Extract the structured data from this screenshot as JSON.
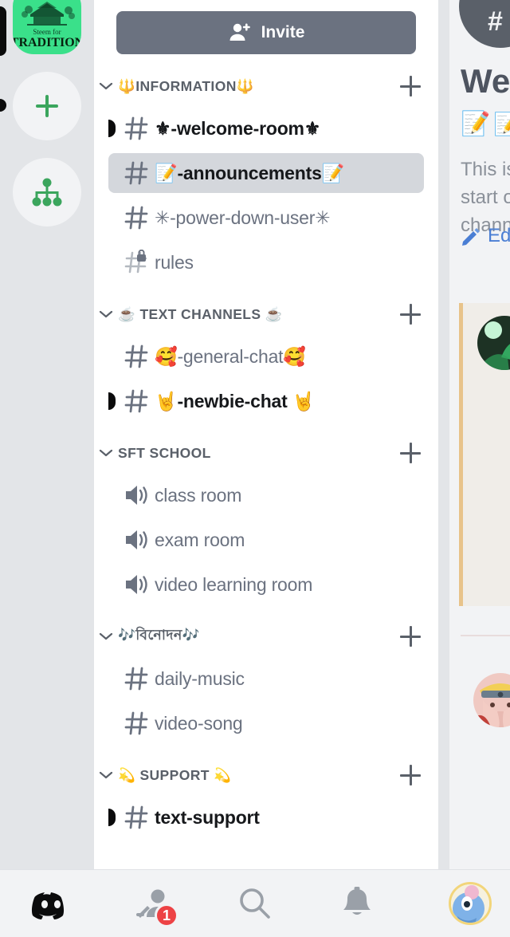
{
  "server_rail": {
    "active_server": {
      "name": "Steem for TRADITION",
      "brand_color": "#3ae08a",
      "line1": "Steem for",
      "line2": "TRADITION"
    },
    "add_server_label": "+",
    "explore_label": "Explore Public Servers"
  },
  "channel_panel": {
    "invite": {
      "label": "Invite",
      "icon": "person-add-icon",
      "bg": "#6b7280"
    },
    "selected_channel": "📝-announcements",
    "categories": [
      {
        "label": "🔱INFORMATION🔱",
        "add_label": "+",
        "channels": [
          {
            "name": "⚜-welcome-room⚜",
            "type": "text",
            "unread": true,
            "selected": false,
            "locked": false
          },
          {
            "name": "📝-announcements📝",
            "type": "text",
            "unread": false,
            "selected": true,
            "locked": false
          },
          {
            "name": "✳-power-down-user✳",
            "type": "text",
            "unread": false,
            "selected": false,
            "locked": false
          },
          {
            "name": "rules",
            "type": "text",
            "unread": false,
            "selected": false,
            "locked": true
          }
        ]
      },
      {
        "label": "☕ TEXT CHANNELS ☕",
        "add_label": "+",
        "channels": [
          {
            "name": "🥰-general-chat🥰",
            "type": "text",
            "unread": false,
            "selected": false,
            "locked": false
          },
          {
            "name": "🤘-newbie-chat 🤘",
            "type": "text",
            "unread": true,
            "selected": false,
            "locked": false
          }
        ]
      },
      {
        "label": "SFT SCHOOL",
        "add_label": "+",
        "channels": [
          {
            "name": "class room",
            "type": "voice",
            "unread": false,
            "selected": false,
            "locked": false
          },
          {
            "name": "exam room",
            "type": "voice",
            "unread": false,
            "selected": false,
            "locked": false
          },
          {
            "name": "video learning room",
            "type": "voice",
            "unread": false,
            "selected": false,
            "locked": false
          }
        ]
      },
      {
        "label": "🎶বিনোদন🎶",
        "add_label": "+",
        "channels": [
          {
            "name": "daily-music",
            "type": "text",
            "unread": false,
            "selected": false,
            "locked": false
          },
          {
            "name": "video-song",
            "type": "text",
            "unread": false,
            "selected": false,
            "locked": false
          }
        ]
      },
      {
        "label": "💫 SUPPORT 💫",
        "add_label": "+",
        "channels": [
          {
            "name": "text-support",
            "type": "text",
            "unread": true,
            "selected": false,
            "locked": false
          }
        ]
      }
    ]
  },
  "chat_panel": {
    "welcome_heading": "Welcome to",
    "channel_title": "📝-announcements📝",
    "description": "This is the start of the channel.",
    "edit_link": "Edit Channel",
    "edit_link_color": "#4a7ed4",
    "mention_border_color": "#e8c38a",
    "mention_bg": "#f0ede8"
  },
  "bottom_nav": {
    "items": [
      {
        "icon": "discord-home-icon",
        "label": "Servers",
        "active": true,
        "badge": null
      },
      {
        "icon": "friends-icon",
        "label": "Friends",
        "active": false,
        "badge": "1"
      },
      {
        "icon": "search-icon",
        "label": "Search",
        "active": false,
        "badge": null
      },
      {
        "icon": "bell-icon",
        "label": "Mentions",
        "active": false,
        "badge": null
      },
      {
        "icon": "user-avatar-icon",
        "label": "You",
        "active": false,
        "badge": null
      }
    ]
  }
}
